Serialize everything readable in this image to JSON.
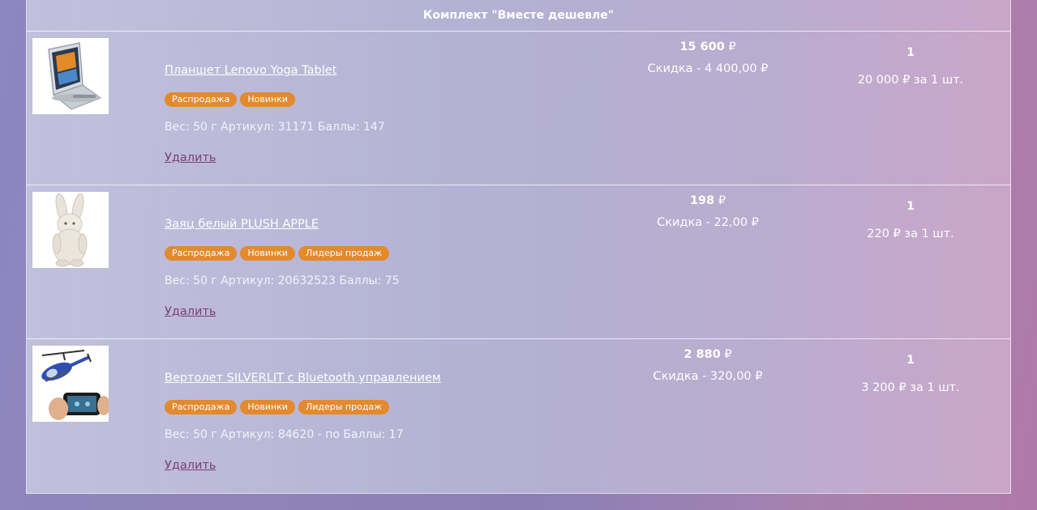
{
  "kit": {
    "title": "Комплект \"Вместе дешевле\""
  },
  "items": [
    {
      "name": "Планшет Lenovo Yoga Tablet",
      "badges": [
        "Распродажа",
        "Новинки"
      ],
      "meta": "Вес: 50 г Артикул: 31171 Баллы: 147",
      "remove": "Удалить",
      "price_value": "15 600",
      "currency": "₽",
      "discount": "Скидка - 4 400,00 ₽",
      "quantity": "1",
      "unit_price": "20 000 ₽ за 1 шт.",
      "image_icon": "tablet-icon"
    },
    {
      "name": "Заяц белый PLUSH APPLE",
      "badges": [
        "Распродажа",
        "Новинки",
        "Лидеры продаж"
      ],
      "meta": "Вес: 50 г Артикул: 20632523 Баллы: 75",
      "remove": "Удалить",
      "price_value": "198",
      "currency": "₽",
      "discount": "Скидка - 22,00 ₽",
      "quantity": "1",
      "unit_price": "220 ₽ за 1 шт.",
      "image_icon": "plush-bunny-icon"
    },
    {
      "name": "Вертолет SILVERLIT с Bluetooth управлением",
      "badges": [
        "Распродажа",
        "Новинки",
        "Лидеры продаж"
      ],
      "meta": "Вес: 50 г Артикул: 84620 - по Баллы: 17",
      "remove": "Удалить",
      "price_value": "2 880",
      "currency": "₽",
      "discount": "Скидка - 320,00 ₽",
      "quantity": "1",
      "unit_price": "3 200 ₽ за 1 шт.",
      "image_icon": "helicopter-icon"
    }
  ],
  "colors": {
    "badge": "#e38a2e",
    "remove_link": "#7a3f7a",
    "text": "#ffffff"
  }
}
